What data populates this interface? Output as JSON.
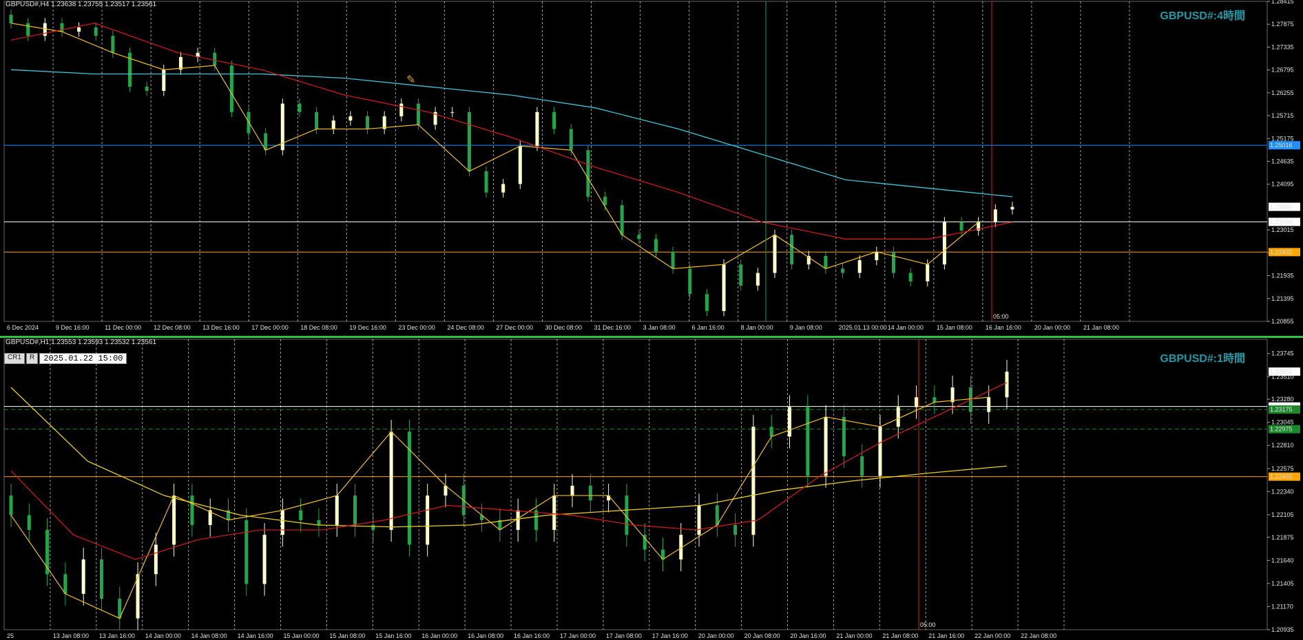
{
  "top": {
    "header": "GBPUSD#,H4  1.23638 1.23755 1.23517 1.23561",
    "symbol": "GBPUSD#:4時間",
    "time_marker": "05:00",
    "price_labels": [
      "1.28415",
      "1.27875",
      "1.27335",
      "1.26795",
      "1.26255",
      "1.25715",
      "1.25175",
      "1.24635",
      "1.24095",
      "1.23015",
      "1.22475",
      "1.21935",
      "1.21395",
      "1.20855"
    ],
    "badges": [
      {
        "text": "1.25016",
        "bg": "#1e90ff"
      },
      {
        "text": "1.23561",
        "bg": "#ffffff"
      },
      {
        "text": "1.23206",
        "bg": "#ffffff"
      },
      {
        "text": "1.22492",
        "bg": "#ffa500"
      }
    ],
    "time_labels": [
      "6 Dec 2024",
      "9 Dec 16:00",
      "11 Dec 00:00",
      "12 Dec 08:00",
      "13 Dec 16:00",
      "17 Dec 00:00",
      "18 Dec 08:00",
      "19 Dec 16:00",
      "23 Dec 00:00",
      "24 Dec 08:00",
      "27 Dec 00:00",
      "30 Dec 08:00",
      "31 Dec 16:00",
      "3 Jan 08:00",
      "6 Jan 16:00",
      "8 Jan 00:00",
      "9 Jan 08:00",
      "2025.01.13 00:00",
      "14 Jan 00:00",
      "15 Jan 08:00",
      "16 Jan 16:00",
      "20 Jan 00:00",
      "21 Jan 08:00"
    ]
  },
  "bottom": {
    "header": "GBPUSD#,H1  1.23553 1.23593 1.23532 1.23561",
    "symbol": "GBPUSD#:1時間",
    "cr_label": "CR1",
    "r_label": "R",
    "datetime_box": "2025.01.22 15:00",
    "time_marker": "05:00",
    "price_labels": [
      "1.23745",
      "1.23510",
      "1.23280",
      "1.23045",
      "1.22810",
      "1.22575",
      "1.22340",
      "1.22105",
      "1.21875",
      "1.21640",
      "1.21405",
      "1.21170",
      "1.20935"
    ],
    "badges": [
      {
        "text": "1.23561",
        "bg": "#ffffff"
      },
      {
        "text": "1.23206",
        "bg": "#ffffff"
      },
      {
        "text": "1.23175",
        "bg": "#1a8a2a"
      },
      {
        "text": "1.22975",
        "bg": "#1a8a2a"
      },
      {
        "text": "1.22492",
        "bg": "#ffa500"
      }
    ],
    "time_labels": [
      "25",
      "13 Jan 08:00",
      "13 Jan 16:00",
      "14 Jan 00:00",
      "14 Jan 08:00",
      "14 Jan 16:00",
      "15 Jan 00:00",
      "15 Jan 08:00",
      "15 Jan 16:00",
      "16 Jan 00:00",
      "16 Jan 08:00",
      "16 Jan 16:00",
      "17 Jan 00:00",
      "17 Jan 08:00",
      "17 Jan 16:00",
      "20 Jan 00:00",
      "20 Jan 08:00",
      "20 Jan 16:00",
      "21 Jan 00:00",
      "21 Jan 08:00",
      "21 Jan 16:00",
      "22 Jan 00:00",
      "22 Jan 08:00"
    ]
  },
  "colors": {
    "background": "#000000",
    "bull_candle": "#ffffcc",
    "bear_candle": "#1fa84a",
    "ma_fast": "#dd1a1a",
    "ma_slow_top": "#40c8d8",
    "ma_slow_bottom": "#e8d020",
    "zigzag": "#f0c020",
    "hline_blue": "#1e90ff",
    "hline_white": "#ffffff",
    "hline_orange": "#ffa500",
    "hline_green": "#1a8a2a",
    "vline_red": "#dd2020",
    "vline_green": "#20a040",
    "grid": "#cccccc"
  },
  "chart_data": [
    {
      "type": "candlestick",
      "title": "GBPUSD#,H4  1.23638 1.23755 1.23517 1.23561",
      "ylim": [
        1.20855,
        1.28415
      ],
      "ma_fast": [
        1.275,
        1.279,
        1.272,
        1.268,
        1.262,
        1.258,
        1.252,
        1.245,
        1.239,
        1.232,
        1.228,
        1.228,
        1.232
      ],
      "ma_slow": [
        1.268,
        1.267,
        1.267,
        1.267,
        1.266,
        1.264,
        1.262,
        1.259,
        1.254,
        1.248,
        1.242,
        1.24,
        1.238
      ],
      "hlines": [
        1.25016,
        1.23206,
        1.22492
      ],
      "closes": [
        1.279,
        1.276,
        1.279,
        1.277,
        1.278,
        1.276,
        1.272,
        1.264,
        1.263,
        1.268,
        1.271,
        1.272,
        1.269,
        1.258,
        1.253,
        1.249,
        1.26,
        1.258,
        1.254,
        1.256,
        1.257,
        1.254,
        1.257,
        1.26,
        1.255,
        1.258,
        1.258,
        1.244,
        1.239,
        1.241,
        1.25,
        1.258,
        1.254,
        1.249,
        1.238,
        1.236,
        1.229,
        1.228,
        1.225,
        1.221,
        1.215,
        1.211,
        1.222,
        1.217,
        1.22,
        1.229,
        1.222,
        1.224,
        1.221,
        1.22,
        1.223,
        1.225,
        1.22,
        1.218,
        1.222,
        1.232,
        1.23,
        1.232,
        1.235,
        1.2356
      ]
    },
    {
      "type": "candlestick",
      "title": "GBPUSD#,H1  1.23553 1.23593 1.23532 1.23561",
      "ylim": [
        1.20935,
        1.2389
      ],
      "ma_fast": [
        1.2255,
        1.219,
        1.2165,
        1.2185,
        1.2195,
        1.2195,
        1.2205,
        1.222,
        1.2215,
        1.221,
        1.22,
        1.2195,
        1.2205,
        1.225,
        1.2285,
        1.2315,
        1.2345
      ],
      "ma_slow": [
        1.234,
        1.2265,
        1.223,
        1.221,
        1.22,
        1.2198,
        1.22,
        1.221,
        1.2215,
        1.222,
        1.2235,
        1.2245,
        1.2253,
        1.226
      ],
      "hlines": [
        1.23206,
        1.23175,
        1.22975,
        1.22492
      ],
      "closes": [
        1.221,
        1.2195,
        1.215,
        1.213,
        1.2165,
        1.2125,
        1.2105,
        1.215,
        1.218,
        1.223,
        1.22,
        1.2215,
        1.2205,
        1.214,
        1.219,
        1.2215,
        1.2205,
        1.22,
        1.223,
        1.22,
        1.2195,
        1.2295,
        1.218,
        1.223,
        1.224,
        1.221,
        1.2205,
        1.2195,
        1.2215,
        1.2195,
        1.223,
        1.224,
        1.2225,
        1.223,
        1.219,
        1.2175,
        1.2165,
        1.219,
        1.222,
        1.22,
        1.219,
        1.23,
        1.229,
        1.232,
        1.225,
        1.231,
        1.227,
        1.225,
        1.23,
        1.232,
        1.233,
        1.2325,
        1.234,
        1.2315,
        1.233,
        1.2356
      ]
    }
  ]
}
